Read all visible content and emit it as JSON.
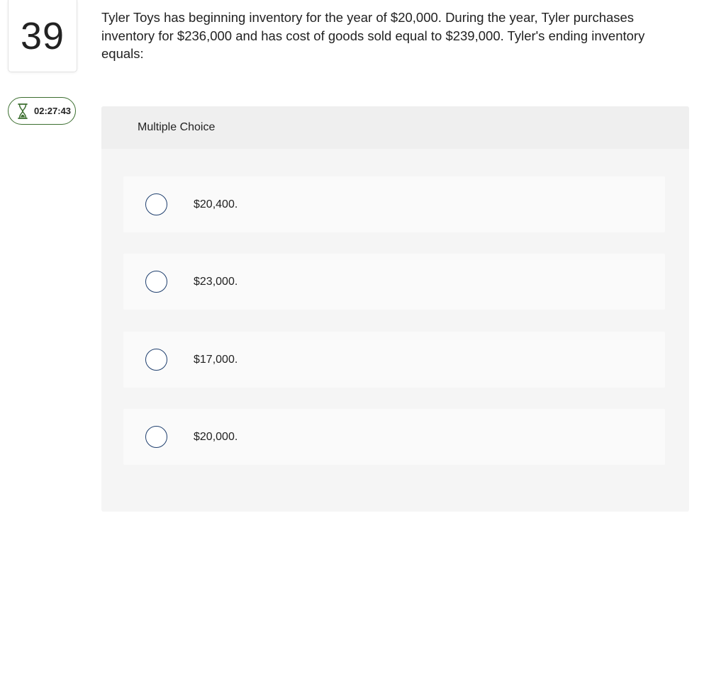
{
  "question": {
    "number": "39",
    "text": "Tyler Toys has beginning inventory for the year of $20,000. During the year, Tyler purchases inventory for $236,000 and has cost of goods sold equal to $239,000. Tyler's ending inventory equals:"
  },
  "timer": {
    "icon": "hourglass-icon",
    "value": "02:27:43",
    "color": "#3b6e2f"
  },
  "answers": {
    "type_label": "Multiple Choice",
    "options": [
      {
        "label": "$20,400."
      },
      {
        "label": "$23,000."
      },
      {
        "label": "$17,000."
      },
      {
        "label": "$20,000."
      }
    ],
    "radio_color": "#1f3f6e"
  }
}
